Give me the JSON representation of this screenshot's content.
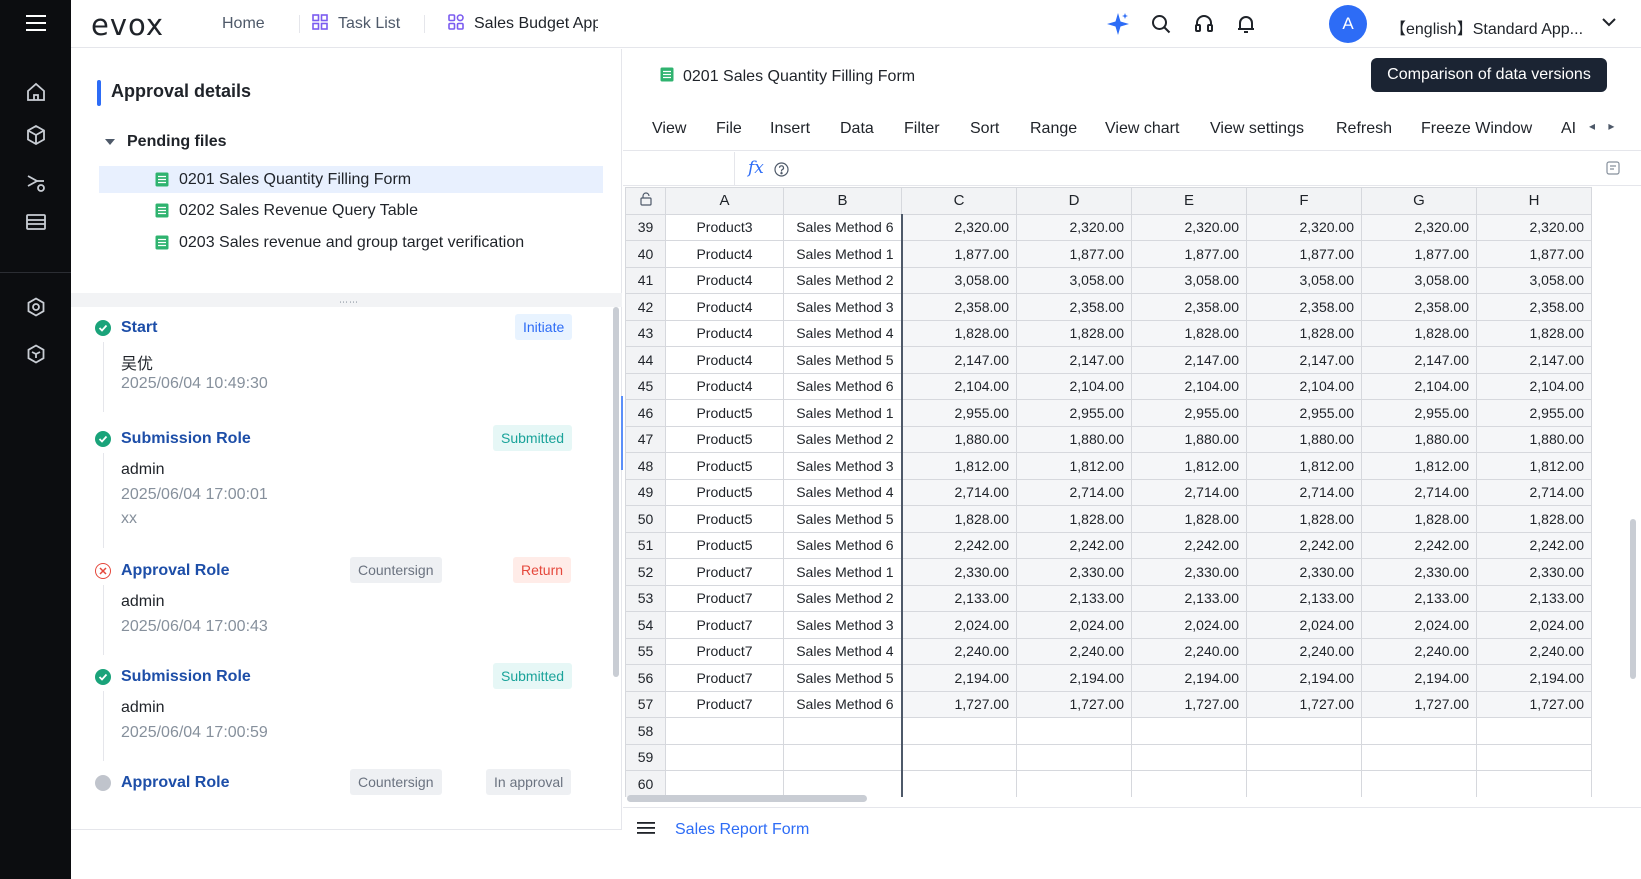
{
  "app": {
    "logo": "evox",
    "nav": {
      "home": "Home",
      "task_list": "Task List",
      "current_tab": "Sales Budget Approv"
    },
    "user": {
      "avatar_letter": "A",
      "name": "【english】Standard App..."
    }
  },
  "left": {
    "title": "Approval details",
    "pending_label": "Pending files",
    "files": [
      "0201 Sales Quantity Filling Form",
      "0202 Sales Revenue Query Table",
      "0203 Sales revenue and group target verification"
    ],
    "steps": [
      {
        "role": "Start",
        "person": "吴优",
        "time": "2025/06/04 10:49:30",
        "note": "",
        "type_tag": "",
        "status": "Initiate",
        "state": "done"
      },
      {
        "role": "Submission Role",
        "person": "admin",
        "time": "2025/06/04 17:00:01",
        "note": "xx",
        "type_tag": "",
        "status": "Submitted",
        "state": "done"
      },
      {
        "role": "Approval Role",
        "person": "admin",
        "time": "2025/06/04 17:00:43",
        "note": "",
        "type_tag": "Countersign",
        "status": "Return",
        "state": "rejected"
      },
      {
        "role": "Submission Role",
        "person": "admin",
        "time": "2025/06/04 17:00:59",
        "note": "",
        "type_tag": "",
        "status": "Submitted",
        "state": "done"
      },
      {
        "role": "Approval Role",
        "person": "",
        "time": "",
        "note": "",
        "type_tag": "Countersign",
        "status": "In approval",
        "state": "pending"
      }
    ]
  },
  "sheet": {
    "title": "0201 Sales Quantity Filling Form",
    "compare_button": "Comparison of data versions",
    "menu": [
      "View",
      "File",
      "Insert",
      "Data",
      "Filter",
      "Sort",
      "Range",
      "View chart",
      "View settings",
      "Refresh",
      "Freeze Window",
      "AI"
    ],
    "columns": [
      "A",
      "B",
      "C",
      "D",
      "E",
      "F",
      "G",
      "H"
    ],
    "rows": [
      {
        "n": "39",
        "a": "Product3",
        "b": "Sales Method 6",
        "v": "2,320.00"
      },
      {
        "n": "40",
        "a": "Product4",
        "b": "Sales Method 1",
        "v": "1,877.00"
      },
      {
        "n": "41",
        "a": "Product4",
        "b": "Sales Method 2",
        "v": "3,058.00"
      },
      {
        "n": "42",
        "a": "Product4",
        "b": "Sales Method 3",
        "v": "2,358.00"
      },
      {
        "n": "43",
        "a": "Product4",
        "b": "Sales Method 4",
        "v": "1,828.00"
      },
      {
        "n": "44",
        "a": "Product4",
        "b": "Sales Method 5",
        "v": "2,147.00"
      },
      {
        "n": "45",
        "a": "Product4",
        "b": "Sales Method 6",
        "v": "2,104.00"
      },
      {
        "n": "46",
        "a": "Product5",
        "b": "Sales Method 1",
        "v": "2,955.00"
      },
      {
        "n": "47",
        "a": "Product5",
        "b": "Sales Method 2",
        "v": "1,880.00"
      },
      {
        "n": "48",
        "a": "Product5",
        "b": "Sales Method 3",
        "v": "1,812.00"
      },
      {
        "n": "49",
        "a": "Product5",
        "b": "Sales Method 4",
        "v": "2,714.00"
      },
      {
        "n": "50",
        "a": "Product5",
        "b": "Sales Method 5",
        "v": "1,828.00"
      },
      {
        "n": "51",
        "a": "Product5",
        "b": "Sales Method 6",
        "v": "2,242.00"
      },
      {
        "n": "52",
        "a": "Product7",
        "b": "Sales Method 1",
        "v": "2,330.00"
      },
      {
        "n": "53",
        "a": "Product7",
        "b": "Sales Method 2",
        "v": "2,133.00"
      },
      {
        "n": "54",
        "a": "Product7",
        "b": "Sales Method 3",
        "v": "2,024.00"
      },
      {
        "n": "55",
        "a": "Product7",
        "b": "Sales Method 4",
        "v": "2,240.00"
      },
      {
        "n": "56",
        "a": "Product7",
        "b": "Sales Method 5",
        "v": "2,194.00"
      },
      {
        "n": "57",
        "a": "Product7",
        "b": "Sales Method 6",
        "v": "1,727.00"
      },
      {
        "n": "58",
        "a": "",
        "b": "",
        "v": ""
      },
      {
        "n": "59",
        "a": "",
        "b": "",
        "v": ""
      },
      {
        "n": "60",
        "a": "",
        "b": "",
        "v": ""
      }
    ],
    "sheet_tab": "Sales Report Form"
  },
  "colors": {
    "accent": "#2d6cf6",
    "success": "#1aa37a",
    "danger": "#e5483c",
    "pending": "#c0c4cc"
  }
}
